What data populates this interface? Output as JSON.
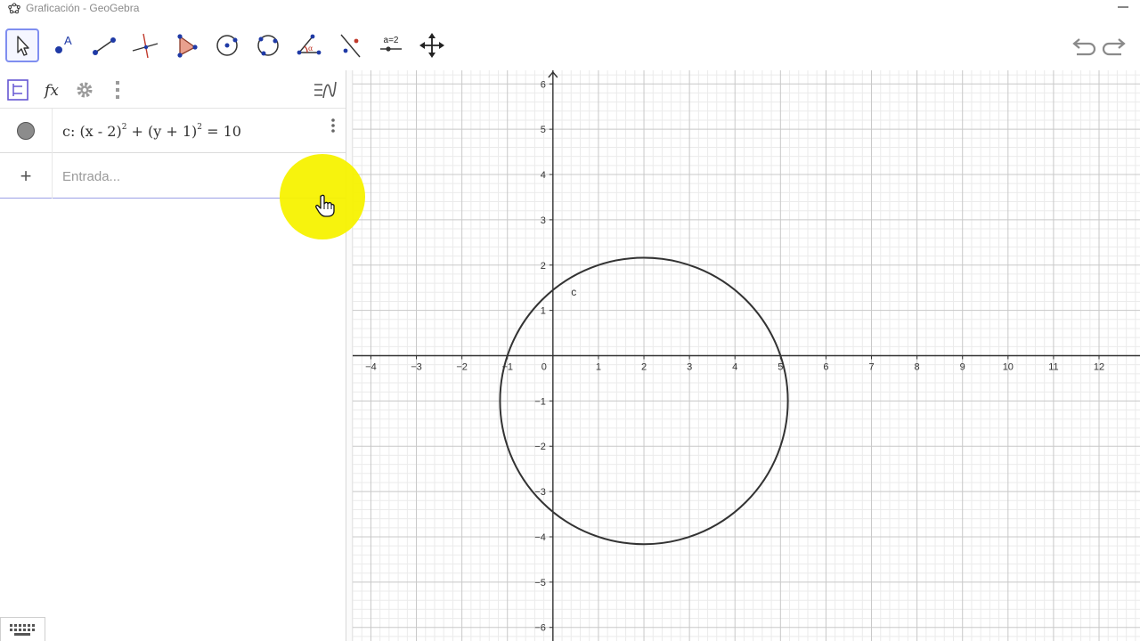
{
  "window": {
    "title": "Graficación - GeoGebra",
    "logo_icon": "geogebra-logo-icon",
    "minimize_icon": "minimize-icon"
  },
  "toolbar": {
    "tools": [
      {
        "name": "move-tool",
        "icon": "arrow-pointer-icon",
        "selected": true
      },
      {
        "name": "point-tool",
        "icon": "point-icon",
        "label": "A"
      },
      {
        "name": "segment-tool",
        "icon": "segment-icon"
      },
      {
        "name": "perpendicular-line-tool",
        "icon": "perpendicular-line-icon"
      },
      {
        "name": "polygon-tool",
        "icon": "polygon-icon"
      },
      {
        "name": "circle-center-point-tool",
        "icon": "circle-center-icon"
      },
      {
        "name": "circle-three-points-tool",
        "icon": "circle-three-points-icon"
      },
      {
        "name": "angle-tool",
        "icon": "angle-icon"
      },
      {
        "name": "reflect-tool",
        "icon": "reflect-icon"
      },
      {
        "name": "slider-tool",
        "icon": "slider-icon",
        "label": "a=2"
      },
      {
        "name": "move-graphics-view-tool",
        "icon": "move-arrows-icon"
      }
    ],
    "undo_icon": "undo-icon",
    "redo_icon": "redo-icon"
  },
  "algebra": {
    "header_buttons": [
      "algebra-view-icon",
      "fx-icon",
      "gear-icon",
      "more-vertical-icon"
    ],
    "fx_label": "fx",
    "graphics_toggle_icon": "graph-toggle-icon",
    "objects": [
      {
        "name": "c",
        "formula_prefix": "c: (x - 2)",
        "formula_mid": " + (y + 1)",
        "formula_end": " = 10",
        "exponent": "2",
        "visible": true
      }
    ],
    "input": {
      "placeholder": "Entrada...",
      "value": "",
      "plus_label": "+"
    },
    "keyboard_icon": "keyboard-icon"
  },
  "graphics": {
    "x_ticks": [
      "−4",
      "−3",
      "−2",
      "−1",
      "0",
      "1",
      "2",
      "3",
      "4",
      "5",
      "6",
      "7",
      "8",
      "9",
      "10",
      "11",
      "12"
    ],
    "y_ticks": [
      "6",
      "5",
      "4",
      "3",
      "2",
      "1",
      "−1",
      "−2",
      "−3",
      "−4",
      "−5",
      "−6"
    ],
    "x_range": [
      -4.4,
      12.9
    ],
    "y_range": [
      -6.3,
      6.3
    ],
    "circle": {
      "label": "c",
      "center": [
        2,
        -1
      ],
      "radius_squared": 10,
      "color": "#333333"
    },
    "grid": true,
    "axis_color": "#333333",
    "major_grid_color": "#c8c8c8",
    "minor_grid_color": "#ebebeb"
  },
  "cursor": {
    "highlight_color": "#f7f200",
    "icon": "hand-pointer-icon"
  }
}
